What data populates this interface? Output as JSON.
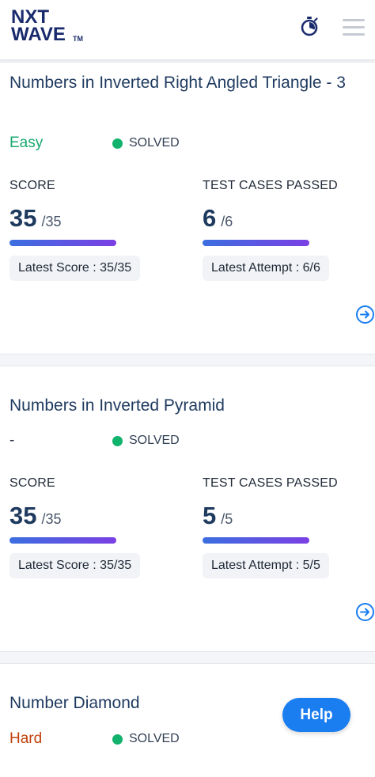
{
  "header": {
    "logo_line1": "NXT",
    "logo_line2": "WAVE",
    "logo_tm": "TM"
  },
  "cards": [
    {
      "title": "Numbers in Inverted Right Angled Triangle - 3",
      "difficulty": "Easy",
      "difficulty_color": "#1aa971",
      "status": "SOLVED",
      "score_label": "SCORE",
      "score": "35",
      "score_total": "/35",
      "tests_label": "TEST CASES PASSED",
      "tests": "6",
      "tests_total": "/6",
      "latest_score": "Latest Score : 35/35",
      "latest_attempt": "Latest Attempt : 6/6"
    },
    {
      "title": "Numbers in Inverted Pyramid",
      "difficulty": "-",
      "difficulty_color": "#1f2937",
      "status": "SOLVED",
      "score_label": "SCORE",
      "score": "35",
      "score_total": "/35",
      "tests_label": "TEST CASES PASSED",
      "tests": "5",
      "tests_total": "/5",
      "latest_score": "Latest Score : 35/35",
      "latest_attempt": "Latest Attempt : 5/5"
    },
    {
      "title": "Number Diamond",
      "difficulty": "Hard",
      "difficulty_color": "#c2410c",
      "status": "SOLVED"
    }
  ],
  "help": {
    "label": "Help"
  },
  "colors": {
    "accent": "#1a7ef0",
    "solved": "#10b26c",
    "navy": "#1e3a5f"
  },
  "icons": [
    "timer-icon",
    "menu-icon",
    "arrow-right-circle-icon"
  ]
}
